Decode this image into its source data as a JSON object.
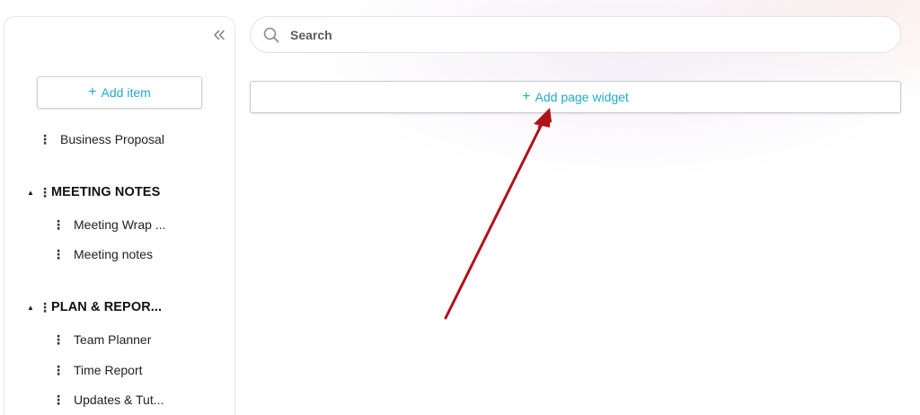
{
  "sidebar": {
    "add_item_label": "Add item",
    "items": [
      {
        "label": "Business Proposal"
      }
    ],
    "sections": [
      {
        "title": "MEETING NOTES",
        "items": [
          {
            "label": "Meeting Wrap ..."
          },
          {
            "label": "Meeting notes"
          }
        ]
      },
      {
        "title": "PLAN & REPOR...",
        "items": [
          {
            "label": "Team Planner"
          },
          {
            "label": "Time Report"
          },
          {
            "label": "Updates & Tut..."
          }
        ]
      }
    ]
  },
  "search": {
    "placeholder": "Search"
  },
  "main": {
    "add_widget_label": "Add page widget"
  },
  "colors": {
    "accent": "#23a9c9",
    "annotation_arrow": "#b0121b"
  }
}
